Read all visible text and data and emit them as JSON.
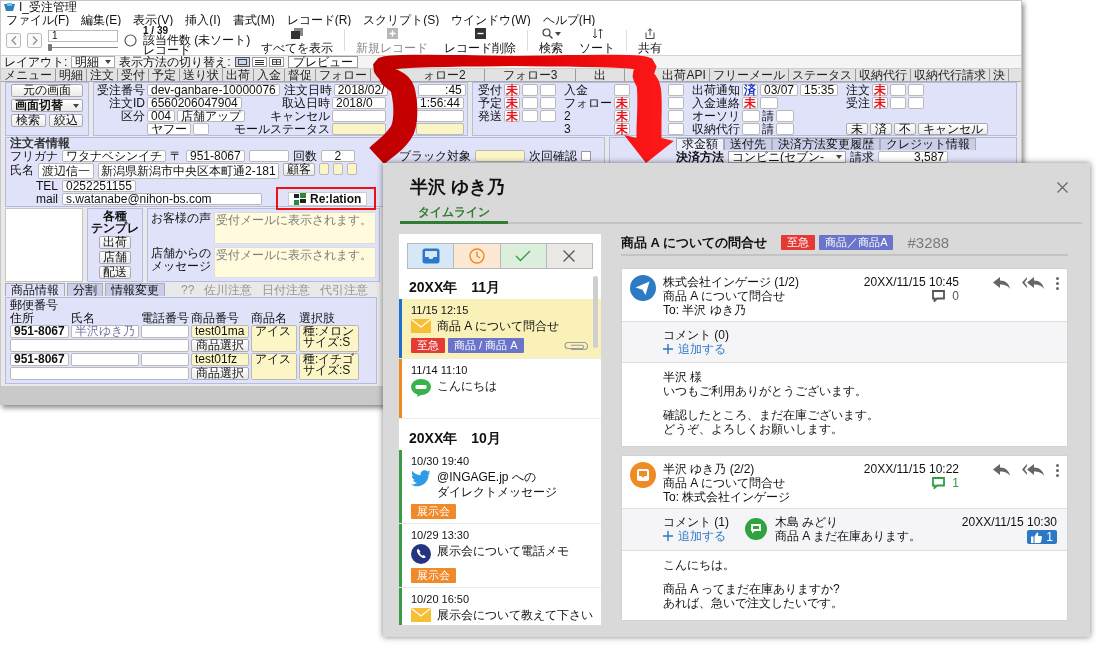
{
  "app": {
    "title": "I_受注管理",
    "menu": [
      "ファイル(F)",
      "編集(E)",
      "表示(V)",
      "挿入(I)",
      "書式(M)",
      "レコード(R)",
      "スクリプト(S)",
      "ウインドウ(W)",
      "ヘルプ(H)"
    ],
    "toolbar": {
      "record_number": "1",
      "record_slider": {
        "level": 0
      },
      "record_count": "1 / 39",
      "found_label": "該当件数 (未ソート)",
      "records_label": "レコード",
      "buttons": [
        {
          "kind": "show_all",
          "label": "すべてを表示",
          "disabled": false
        },
        {
          "kind": "new",
          "label": "新規レコード",
          "disabled": true
        },
        {
          "kind": "delete",
          "label": "レコード削除",
          "disabled": false
        },
        {
          "kind": "search",
          "label": "検索",
          "disabled": false
        },
        {
          "kind": "sort",
          "label": "ソート",
          "disabled": false
        },
        {
          "kind": "share",
          "label": "共有",
          "disabled": false
        }
      ]
    },
    "layout_bar": {
      "layout_label": "レイアウト:",
      "layout_value": "明細",
      "view_label": "表示方法の切り替え:",
      "views": [
        {
          "kind": "form",
          "selected": true
        },
        {
          "kind": "list",
          "selected": false
        },
        {
          "kind": "table",
          "selected": false
        }
      ],
      "preview_button": "プレビュー"
    },
    "tabs": [
      "メニュー",
      "明細",
      "注文",
      "受付",
      "予定",
      "送り状",
      "出荷",
      "入金",
      "督促",
      "フォロー",
      "ォロー2",
      "フォロー3",
      "出",
      "出荷API",
      "フリーメール",
      "ステータス",
      "収納代行",
      "収納代行請求",
      "決"
    ],
    "nav_box": {
      "back_button": "元の画面",
      "screen_select": "画面切替",
      "buttons": [
        "検索",
        "絞込"
      ]
    },
    "order_box": {
      "rows": [
        [
          {
            "label": "受注番号",
            "cells": [
              {
                "kind": "field",
                "value": "dev-ganbare-10000076"
              }
            ]
          },
          {
            "label": "注文日時",
            "cells": [
              {
                "kind": "field",
                "value": "2018/02/"
              },
              {
                "kind": "field",
                "value": ":45"
              }
            ]
          }
        ],
        [
          {
            "label": "注文ID",
            "cells": [
              {
                "kind": "field",
                "value": "6560206047904"
              }
            ]
          },
          {
            "label": "取込日時",
            "cells": [
              {
                "kind": "field",
                "value": "2018/0"
              },
              {
                "kind": "field",
                "value": "1:56:44"
              }
            ]
          }
        ],
        [
          {
            "label": "区分",
            "cells": [
              {
                "kind": "field",
                "value": "004"
              },
              {
                "kind": "field",
                "value": "店舗アップ"
              }
            ]
          },
          {
            "label": "キャンセル",
            "cells": [
              {
                "kind": "field"
              },
              {
                "kind": "field"
              }
            ]
          }
        ],
        [
          {
            "cells": [
              {
                "kind": "field",
                "value": "ヤフー"
              },
              {
                "kind": "field"
              }
            ]
          },
          {
            "label": "モールステータス",
            "cells": [
              {
                "kind": "field",
                "color": "#fcf6c6"
              },
              {
                "kind": "field",
                "color": "#fcf6c6"
              }
            ]
          }
        ]
      ]
    },
    "status_box": {
      "groups": [
        [
          {
            "label": "受付",
            "cells": [
              {
                "kind": "status",
                "text": "未",
                "color": "#e8141c"
              },
              {
                "kind": "field"
              },
              {
                "kind": "field"
              }
            ]
          },
          {
            "label": "予定",
            "cells": [
              {
                "kind": "status",
                "text": "未",
                "color": "#e8141c"
              },
              {
                "kind": "field"
              },
              {
                "kind": "field"
              }
            ]
          },
          {
            "label": "発送",
            "cells": [
              {
                "kind": "status",
                "text": "未",
                "color": "#e8141c"
              },
              {
                "kind": "field"
              },
              {
                "kind": "field"
              }
            ]
          }
        ],
        [
          {
            "label": "入金",
            "cells": [
              {
                "kind": "field"
              },
              {
                "kind": "field"
              }
            ]
          },
          {
            "label": "フォロー",
            "cells": [
              {
                "kind": "status",
                "text": "未",
                "color": "#e8141c"
              },
              {
                "kind": "field"
              }
            ]
          },
          {
            "label": "2",
            "cells": [
              {
                "kind": "status",
                "text": "未",
                "color": "#e8141c"
              },
              {
                "kind": "field"
              }
            ]
          },
          {
            "label": "3",
            "cells": [
              {
                "kind": "status",
                "text": "未",
                "color": "#e8141c"
              },
              {
                "kind": "field"
              }
            ]
          }
        ],
        [
          {
            "label": "出荷通知",
            "cells": [
              {
                "kind": "status",
                "text": "済",
                "color": "#1b35d1"
              },
              {
                "kind": "field",
                "value": "03/07"
              },
              {
                "kind": "field",
                "value": "15:35"
              }
            ]
          },
          {
            "label": "入金連絡",
            "cells": [
              {
                "kind": "status",
                "text": "未",
                "color": "#e8141c"
              },
              {
                "kind": "field"
              }
            ]
          },
          {
            "label": "オーソリ",
            "cells": [
              {
                "kind": "field"
              },
              {
                "kind": "text",
                "text": "請"
              },
              {
                "kind": "field"
              }
            ]
          },
          {
            "label": "収納代行",
            "cells": [
              {
                "kind": "field"
              },
              {
                "kind": "text",
                "text": "請"
              },
              {
                "kind": "field"
              }
            ]
          }
        ],
        [
          {
            "label": "注文",
            "cells": [
              {
                "kind": "status",
                "text": "未",
                "color": "#e8141c"
              },
              {
                "kind": "field"
              },
              {
                "kind": "field"
              }
            ]
          },
          {
            "label": "受注",
            "cells": [
              {
                "kind": "status",
                "text": "未",
                "color": "#e8141c"
              },
              {
                "kind": "field"
              },
              {
                "kind": "field"
              }
            ]
          },
          {
            "cells": [
              {
                "kind": "button",
                "text": "未"
              },
              {
                "kind": "button",
                "text": "済"
              },
              {
                "kind": "button",
                "text": "不"
              },
              {
                "kind": "button",
                "text": "キャンセル"
              }
            ]
          }
        ]
      ]
    },
    "customer": {
      "heading": "注文者情報",
      "furigana_label": "フリガナ",
      "furigana": "ワタナベシンイチ",
      "zip_label": "〒",
      "zip": "951-8067",
      "count_label": "回数",
      "count": "2",
      "blacklist_label": "ブラック対象",
      "blacklist_field": {
        "color": "#fcf6c6"
      },
      "next_check_label": "次回確認",
      "next_check": false,
      "name_label": "氏名",
      "name": "渡辺信一",
      "address": "新潟県新潟市中央区本町通2-181",
      "customer_button": "顧客",
      "note_fields": [
        {
          "color": "#fcf6c6"
        },
        {
          "color": "#fcf6c6"
        },
        {
          "color": "#fcf6c6"
        }
      ],
      "tel_label": "TEL",
      "tel": "0252251155",
      "mail_label": "mail",
      "mail": "s.watanabe@nihon-bs.com",
      "relation_button": {
        "label": "Re:lation",
        "highlighted": true
      }
    },
    "payment": {
      "tabs": [
        {
          "label": "求金額",
          "selected": true
        },
        {
          "label": "送付先",
          "selected": false
        },
        {
          "label": "決済方法変更履歴",
          "selected": false
        },
        {
          "label": "クレジット情報",
          "selected": false
        }
      ],
      "method_label": "決済方法",
      "method": "コンビニ(セブン-",
      "billing_label": "請求",
      "billing": "3,587"
    },
    "templates": {
      "label_lines": [
        "各種",
        "テンプレ"
      ],
      "buttons": [
        "出荷",
        "店舗",
        "配送"
      ]
    },
    "message_fields": [
      {
        "label_lines": [
          "お客様の声"
        ],
        "placeholder": "受付メールに表示されます。"
      },
      {
        "label_lines": [
          "店舗からの",
          "メッセージ"
        ],
        "placeholder": "受付メールに表示されます。"
      }
    ],
    "notices": [
      {
        "label": "??",
        "disabled": true
      },
      {
        "label": "佐川注意",
        "disabled": true
      },
      {
        "label": "日付注意",
        "disabled": true
      },
      {
        "label": "代引注意",
        "disabled": true
      }
    ],
    "product_tabs": [
      {
        "label": "商品情報",
        "selected": true
      },
      {
        "label": "分割",
        "selected": false
      },
      {
        "label": "情報変更",
        "selected": false
      }
    ],
    "product_table": {
      "zip_heading": "郵便番号",
      "columns": [
        "住所",
        "氏名",
        "電話番号",
        "商品番号",
        "商品名",
        "選択肢"
      ],
      "rows": [
        {
          "zip": "951-8067",
          "name": "半沢ゆき乃",
          "code": "test01ma",
          "product": "アイス",
          "options": [
            "種:メロン",
            "サイズ:S"
          ],
          "button": "商品選択"
        },
        {
          "zip": "951-8067",
          "code": "test01fz",
          "product": "アイス",
          "options": [
            "種:イチゴ",
            "サイズ:S"
          ],
          "button": "商品選択"
        }
      ]
    }
  },
  "contact_panel": {
    "name": "半沢 ゆき乃",
    "tabs": [
      {
        "label": "タイムライン",
        "selected": true
      }
    ],
    "filters": [
      {
        "kind": "inbox"
      },
      {
        "kind": "pending"
      },
      {
        "kind": "done"
      },
      {
        "kind": "closed"
      }
    ],
    "months": [
      {
        "heading": "20XX年　11月",
        "items": [
          {
            "time": "11/15 12:15",
            "kind": "mail",
            "lines": [
              "商品 A について問合せ"
            ],
            "tags": [
              {
                "text": "至急",
                "color": "#e53935"
              },
              {
                "text": "商品 / 商品 A",
                "color": "#6a74c9"
              }
            ],
            "attachment": true,
            "selected": true,
            "color": "#1e6fd0"
          },
          {
            "time": "11/14 11:10",
            "kind": "line",
            "lines": [
              "こんにちは"
            ],
            "attachment": false,
            "selected": false,
            "color": "#ef8a1f"
          }
        ]
      },
      {
        "heading": "20XX年　10月",
        "items": [
          {
            "time": "10/30 19:40",
            "kind": "twitter",
            "lines": [
              "@INGAGE.jp への",
              "ダイレクトメッセージ"
            ],
            "tags": [
              {
                "text": "展示会",
                "color": "#f0892a"
              }
            ],
            "attachment": false,
            "selected": false,
            "color": "#3a9a45"
          },
          {
            "time": "10/29 13:30",
            "kind": "phone",
            "lines": [
              "展示会について電話メモ"
            ],
            "tags": [
              {
                "text": "展示会",
                "color": "#f0892a"
              }
            ],
            "attachment": false,
            "selected": false,
            "color": "#3a9a45"
          },
          {
            "time": "10/20 16:50",
            "kind": "mail",
            "lines": [
              "展示会について教えて下さい"
            ],
            "attachment": false,
            "selected": false,
            "color": "#3a9a45"
          }
        ]
      }
    ],
    "thread": {
      "subject": "商品 A についての問合せ",
      "tags": [
        {
          "text": "至急",
          "color": "#e53935"
        },
        {
          "text": "商品／商品A",
          "color": "#6a74c9"
        }
      ],
      "number": "#3288",
      "messages": [
        {
          "kind": "outgoing",
          "sender": "株式会社インゲージ (1/2)",
          "subject": "商品 A について問合せ",
          "to": "To: 半沢 ゆき乃",
          "date": "20XX/11/15 10:45",
          "comment_count": "0",
          "commented": false,
          "comment_heading": "コメント (0)",
          "add_comment": "追加する",
          "body": [
            [
              "半沢 様",
              "いつもご利用ありがとうございます。"
            ],
            [
              "確認したところ、まだ在庫ございます。",
              "どうぞ、よろしくお願いします。"
            ]
          ]
        },
        {
          "kind": "incoming",
          "sender": "半沢 ゆき乃 (2/2)",
          "subject": "商品 A について問合せ",
          "to": "To: 株式会社インゲージ",
          "date": "20XX/11/15 10:22",
          "comment_count": "1",
          "commented": true,
          "comment_heading": "コメント (1)",
          "add_comment": "追加する",
          "comments": [
            {
              "author": "木島 みどり",
              "text": "商品 A まだ在庫あります。",
              "date": "20XX/11/15 10:30",
              "likes": "1"
            }
          ],
          "body": [
            [
              "こんにちは。"
            ],
            [
              "商品 A ってまだ在庫ありますか?",
              "あれば、急いで注文したいです。"
            ]
          ]
        }
      ]
    }
  }
}
